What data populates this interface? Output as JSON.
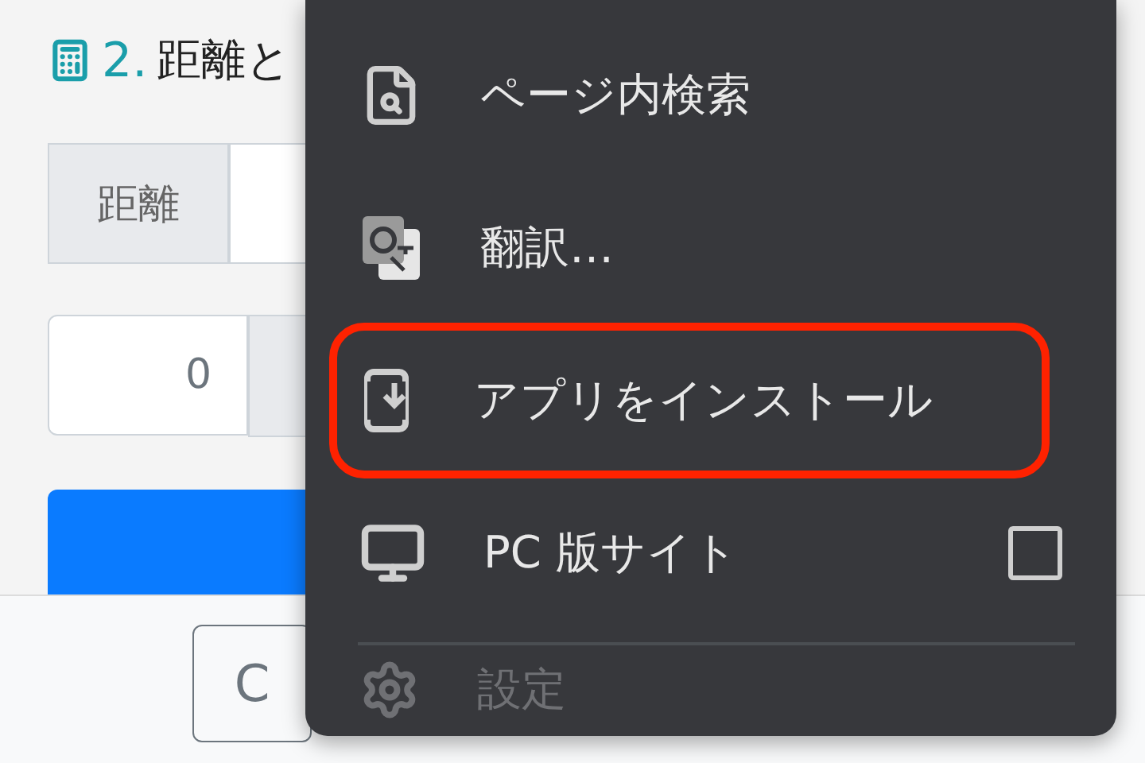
{
  "page": {
    "heading": {
      "number": "2.",
      "title": "距離と"
    },
    "distance_label": "距離",
    "time_value": "0",
    "bottom_button": "C"
  },
  "menu": {
    "items": [
      {
        "kind": "find",
        "label": "ページ内検索",
        "highlighted": false,
        "dimmed": false
      },
      {
        "kind": "translate",
        "label": "翻訳…",
        "highlighted": false,
        "dimmed": false
      },
      {
        "kind": "install",
        "label": "アプリをインストール",
        "highlighted": true,
        "dimmed": false
      },
      {
        "kind": "desktop",
        "label": "PC 版サイト",
        "highlighted": false,
        "dimmed": false,
        "checked": false
      },
      {
        "kind": "settings",
        "label": "設定",
        "highlighted": false,
        "dimmed": true
      }
    ]
  }
}
